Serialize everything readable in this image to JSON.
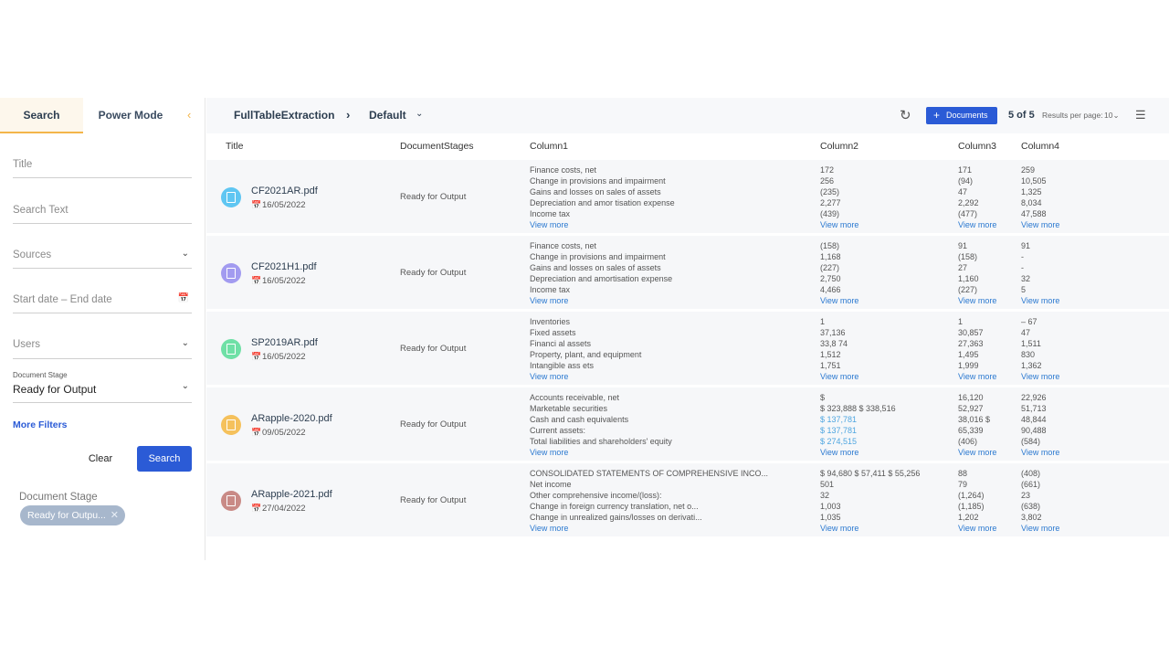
{
  "sidebar": {
    "tabs": [
      {
        "label": "Search"
      },
      {
        "label": "Power Mode"
      }
    ],
    "fields": {
      "title": "Title",
      "search_text": "Search Text",
      "sources": "Sources",
      "date_range": "Start date – End date",
      "users": "Users",
      "stage_label": "Document Stage",
      "stage_value": "Ready for Output"
    },
    "more_filters": "More Filters",
    "clear_label": "Clear",
    "search_label": "Search",
    "applied_label": "Document Stage",
    "chip_label": "Ready for Outpu..."
  },
  "header": {
    "crumb1": "FullTableExtraction",
    "crumb2": "Default",
    "docs_button": "Documents",
    "count": "5 of 5",
    "rpp_label": "Results per page:",
    "rpp_value": "10"
  },
  "table": {
    "headers": [
      "Title",
      "DocumentStages",
      "Column1",
      "Column2",
      "Column3",
      "Column4"
    ],
    "view_more": "View more",
    "rows": [
      {
        "name": "CF2021AR.pdf",
        "date": "16/05/2022",
        "stage": "Ready for Output",
        "icon_color": "#5fc6f2",
        "c1": [
          "Finance costs, net",
          "Change in provisions and impairment",
          "Gains and losses on sales of assets",
          "Depreciation and amor tisation expense",
          "Income tax"
        ],
        "c2": [
          "172",
          "256",
          "(235)",
          "2,277",
          "(439)"
        ],
        "c3": [
          "171",
          "(94)",
          "47",
          "2,292",
          "(477)"
        ],
        "c4": [
          "259",
          "10,505",
          "1,325",
          "8,034",
          "47,588"
        ]
      },
      {
        "name": "CF2021H1.pdf",
        "date": "16/05/2022",
        "stage": "Ready for Output",
        "icon_color": "#a29bf0",
        "c1": [
          "Finance costs, net",
          "Change in provisions and impairment",
          "Gains and losses on sales of assets",
          "Depreciation and amortisation expense",
          "Income tax"
        ],
        "c2": [
          "(158)",
          "1,168",
          "(227)",
          "2,750",
          "4,466"
        ],
        "c3": [
          "91",
          "(158)",
          "27",
          "1,160",
          "(227)"
        ],
        "c4": [
          "91",
          "-",
          "-",
          "32",
          "5"
        ]
      },
      {
        "name": "SP2019AR.pdf",
        "date": "16/05/2022",
        "stage": "Ready for Output",
        "icon_color": "#6fe0a6",
        "c1": [
          "Inventories",
          "Fixed assets",
          "Financi al assets",
          "Property, plant, and equipment",
          "Intangible ass ets"
        ],
        "c2": [
          "1",
          "37,136",
          "33,8 74",
          "1,512",
          "1,751"
        ],
        "c3": [
          "1",
          "30,857",
          "27,363",
          "1,495",
          "1,999"
        ],
        "c4": [
          "– 67",
          "47",
          "1,511",
          "830",
          "1,362"
        ]
      },
      {
        "name": "ARapple-2020.pdf",
        "date": "09/05/2022",
        "stage": "Ready for Output",
        "icon_color": "#f5c15c",
        "c1": [
          "Accounts receivable, net",
          "Marketable securities",
          "Cash and cash equivalents",
          "Current assets:",
          "Total liabilities and shareholders' equity"
        ],
        "c2": [
          "$",
          "$ 323,888 $ 338,516",
          "$ 137,781",
          "$ 137,781",
          "$ 274,515"
        ],
        "c3": [
          "16,120",
          "52,927",
          "38,016 $",
          "65,339",
          "(406)"
        ],
        "c4": [
          "22,926",
          "51,713",
          "48,844",
          "90,488",
          "(584)"
        ]
      },
      {
        "name": "ARapple-2021.pdf",
        "date": "27/04/2022",
        "stage": "Ready for Output",
        "icon_color": "#c98a86",
        "c1": [
          "CONSOLIDATED STATEMENTS OF COMPREHENSIVE INCO...",
          "Net income",
          "Other comprehensive income/(loss):",
          "Change in foreign currency translation, net o...",
          "Change in unrealized gains/losses on derivati..."
        ],
        "c2": [
          "$ 94,680 $ 57,411 $ 55,256",
          "501",
          "32",
          "1,003",
          "1,035"
        ],
        "c3": [
          "88",
          "79",
          "(1,264)",
          "(1,185)",
          "1,202"
        ],
        "c4": [
          "(408)",
          "(661)",
          "23",
          "(638)",
          "3,802"
        ]
      }
    ]
  }
}
